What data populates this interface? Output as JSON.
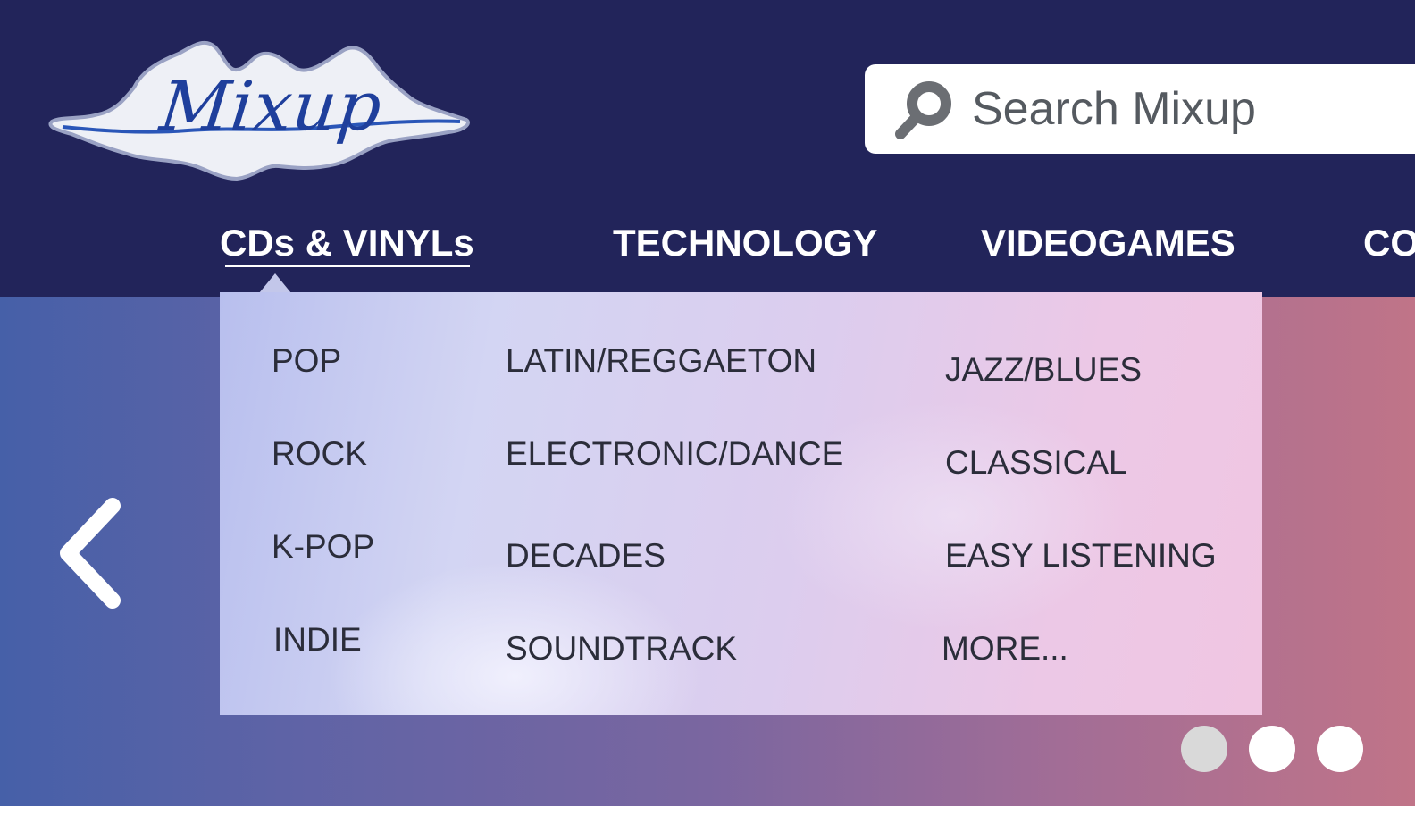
{
  "logo": {
    "text": "Mixup"
  },
  "search": {
    "placeholder": "Search Mixup",
    "icon": "search-icon"
  },
  "nav": {
    "items": [
      {
        "label": "CDs & VINYLs",
        "active": true
      },
      {
        "label": "TECHNOLOGY"
      },
      {
        "label": "VIDEOGAMES"
      },
      {
        "label": "CO"
      }
    ]
  },
  "dropdown": {
    "columns": [
      [
        "POP",
        "ROCK",
        "K-POP",
        "INDIE"
      ],
      [
        "LATIN/REGGAETON",
        "ELECTRONIC/DANCE",
        "DECADES",
        "SOUNDTRACK"
      ],
      [
        "JAZZ/BLUES",
        "CLASSICAL",
        "EASY LISTENING",
        "MORE..."
      ]
    ]
  },
  "carousel": {
    "prev_icon": "chevron-left-icon",
    "dots": [
      {
        "active": true,
        "color": "#d9d9d9"
      },
      {
        "active": false,
        "color": "#ffffff"
      },
      {
        "active": false,
        "color": "#ffffff"
      }
    ]
  },
  "colors": {
    "header_bg": "#22245a",
    "text_dark": "#2b2d3a"
  }
}
